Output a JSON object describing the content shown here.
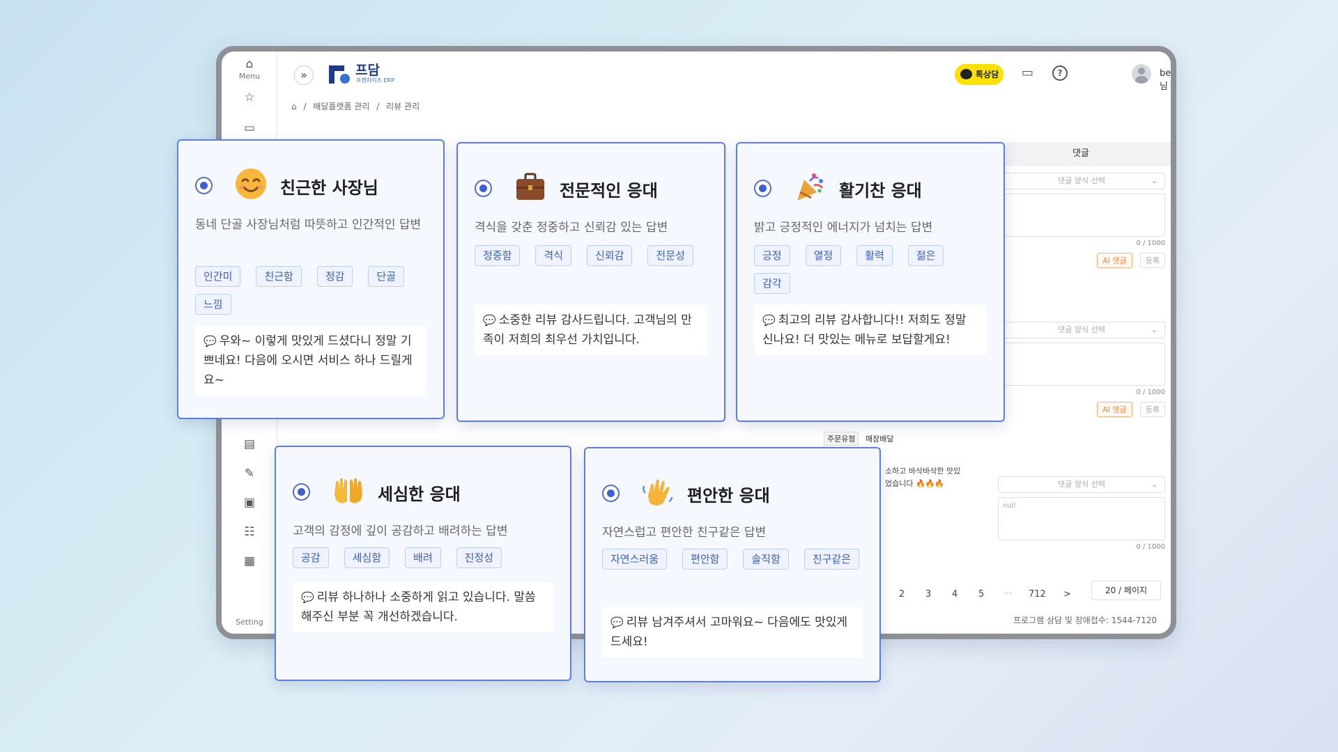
{
  "rail": {
    "menu_label": "Menu",
    "setting_label": "Setting"
  },
  "header": {
    "logo_text": "프담",
    "logo_sub": "프랜차이즈 ERP",
    "kakao_label": "톡상담",
    "user_name": "benter 님"
  },
  "breadcrumb": [
    "배달플랫폼 관리",
    "리뷰 관리"
  ],
  "background": {
    "reply_column": "댓글",
    "reply_select_placeholder": "댓글 양식 선택",
    "reply_null": "null",
    "reply_count": "0 / 1000",
    "ai_reply": "AI 댓글",
    "register": "등록",
    "order_type_label": "주문유형",
    "order_type_value": "매장배달",
    "review_fragment_1": "소하고 바삭바삭한 맛있",
    "review_fragment_2": "었습니다 🔥🔥🔥",
    "pager": [
      "2",
      "3",
      "4",
      "5",
      "···",
      "712",
      ">"
    ],
    "per_page": "20 / 페이지",
    "footer": "프로그램 상담 및 장애접수: 1544-7120"
  },
  "cards": [
    {
      "emoji": "smiling-face-icon",
      "title": "친근한 사장님",
      "desc": "동네 단골 사장님처럼 따뜻하고 인간적인 답변",
      "tags": [
        "인간미",
        "친근함",
        "정감",
        "단골",
        "느낌"
      ],
      "sample": "우와~ 이렇게 맛있게 드셨다니 정말 기쁘네요! 다음에 오시면 서비스 하나 드릴게요~"
    },
    {
      "emoji": "briefcase-icon",
      "title": "전문적인 응대",
      "desc": "격식을 갖춘 정중하고 신뢰감 있는 답변",
      "tags": [
        "정중함",
        "격식",
        "신뢰감",
        "전문성"
      ],
      "sample": "소중한 리뷰 감사드립니다. 고객님의 만족이 저희의 최우선 가치입니다."
    },
    {
      "emoji": "party-popper-icon",
      "title": "활기찬 응대",
      "desc": "밝고 긍정적인 에너지가 넘치는 답변",
      "tags": [
        "긍정",
        "열정",
        "활력",
        "젊은",
        "감각"
      ],
      "sample": "최고의 리뷰 감사합니다!! 저희도 정말 신나요! 더 맛있는 메뉴로 보답할게요!"
    },
    {
      "emoji": "open-hands-icon",
      "title": "세심한 응대",
      "desc": "고객의 감정에 깊이 공감하고 배려하는 답변",
      "tags": [
        "공감",
        "세심함",
        "배려",
        "진정성"
      ],
      "sample": "리뷰 하나하나 소중하게 읽고 있습니다. 말씀해주신 부분 꼭 개선하겠습니다."
    },
    {
      "emoji": "waving-hand-icon",
      "title": "편안한 응대",
      "desc": "자연스럽고 편안한 친구같은 답변",
      "tags": [
        "자연스러움",
        "편안함",
        "솔직함",
        "친구같은"
      ],
      "sample": "리뷰 남겨주셔서 고마워요~ 다음에도 맛있게 드세요!"
    }
  ]
}
